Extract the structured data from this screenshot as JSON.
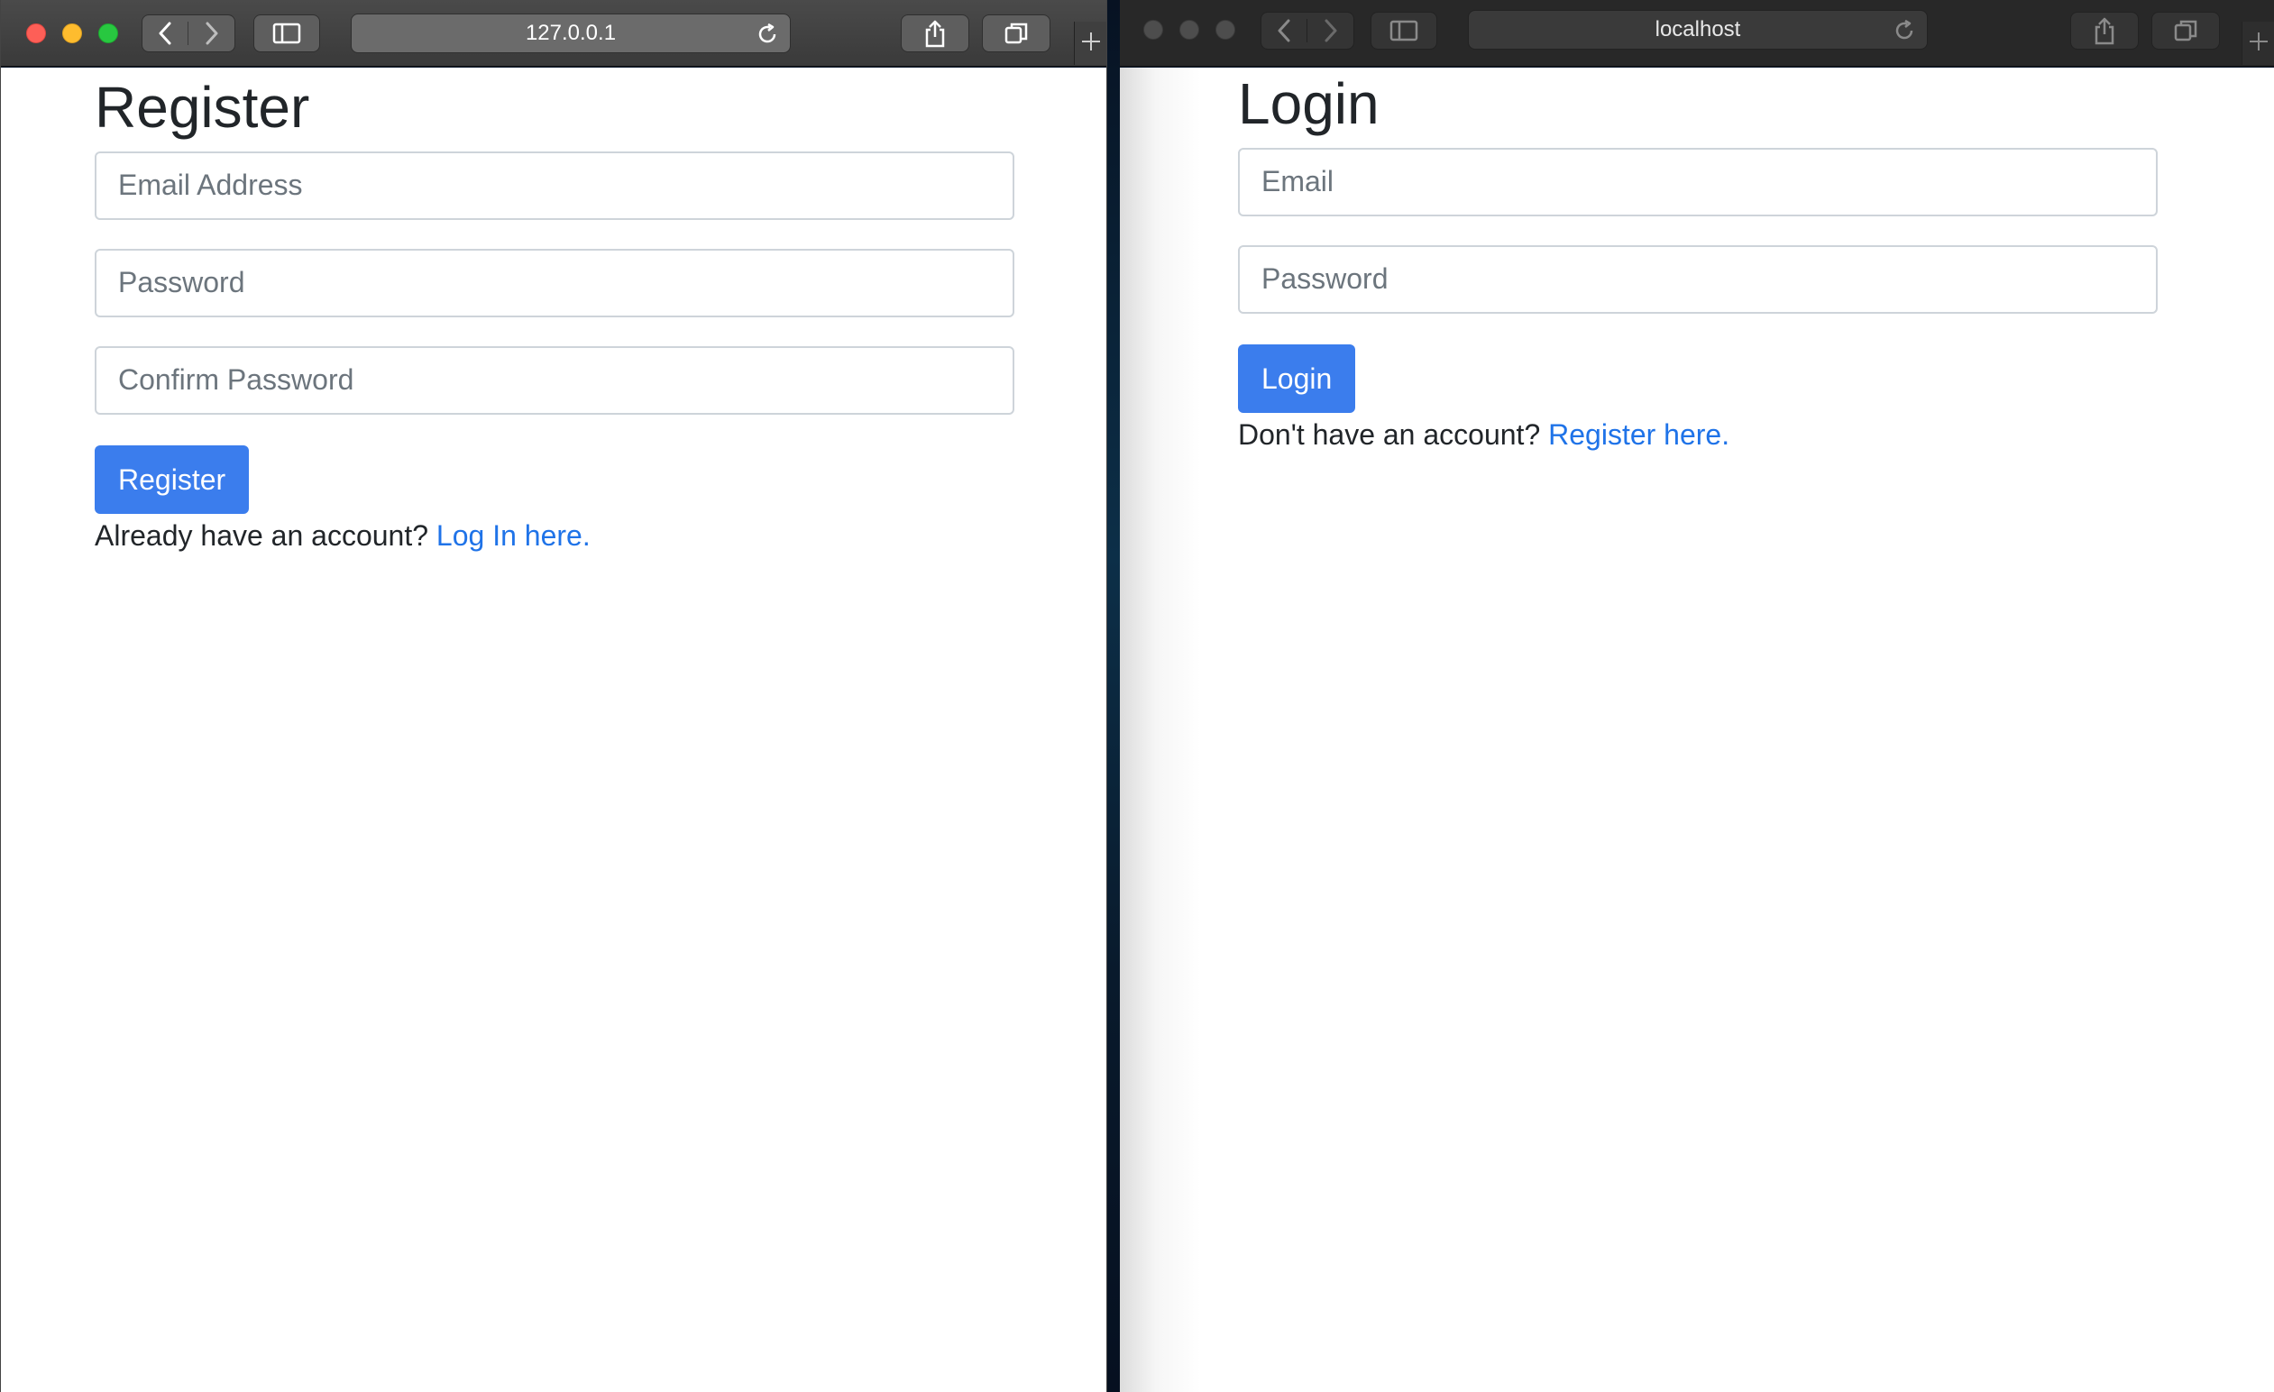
{
  "left_window": {
    "address": "127.0.0.1",
    "page_title": "Register",
    "fields": [
      {
        "placeholder": "Email Address"
      },
      {
        "placeholder": "Password"
      },
      {
        "placeholder": "Confirm Password"
      }
    ],
    "submit_label": "Register",
    "alt_prompt": "Already have an account?",
    "alt_link": "Log In here."
  },
  "right_window": {
    "address": "localhost",
    "page_title": "Login",
    "fields": [
      {
        "placeholder": "Email"
      },
      {
        "placeholder": "Password"
      }
    ],
    "submit_label": "Login",
    "alt_prompt": "Don't have an account?",
    "alt_link": "Register here."
  },
  "colors": {
    "primary_button": "#3b7ded",
    "link": "#1f73e8",
    "close": "#fd5f57",
    "minimize": "#febc2e",
    "maximize": "#28c840"
  },
  "icons": {
    "traffic_lights": [
      "close-icon",
      "minimize-icon",
      "maximize-icon"
    ],
    "toolbar": [
      "back-icon",
      "forward-icon",
      "sidebar-icon",
      "reload-icon",
      "share-icon",
      "tabs-icon",
      "new-tab-icon"
    ]
  }
}
